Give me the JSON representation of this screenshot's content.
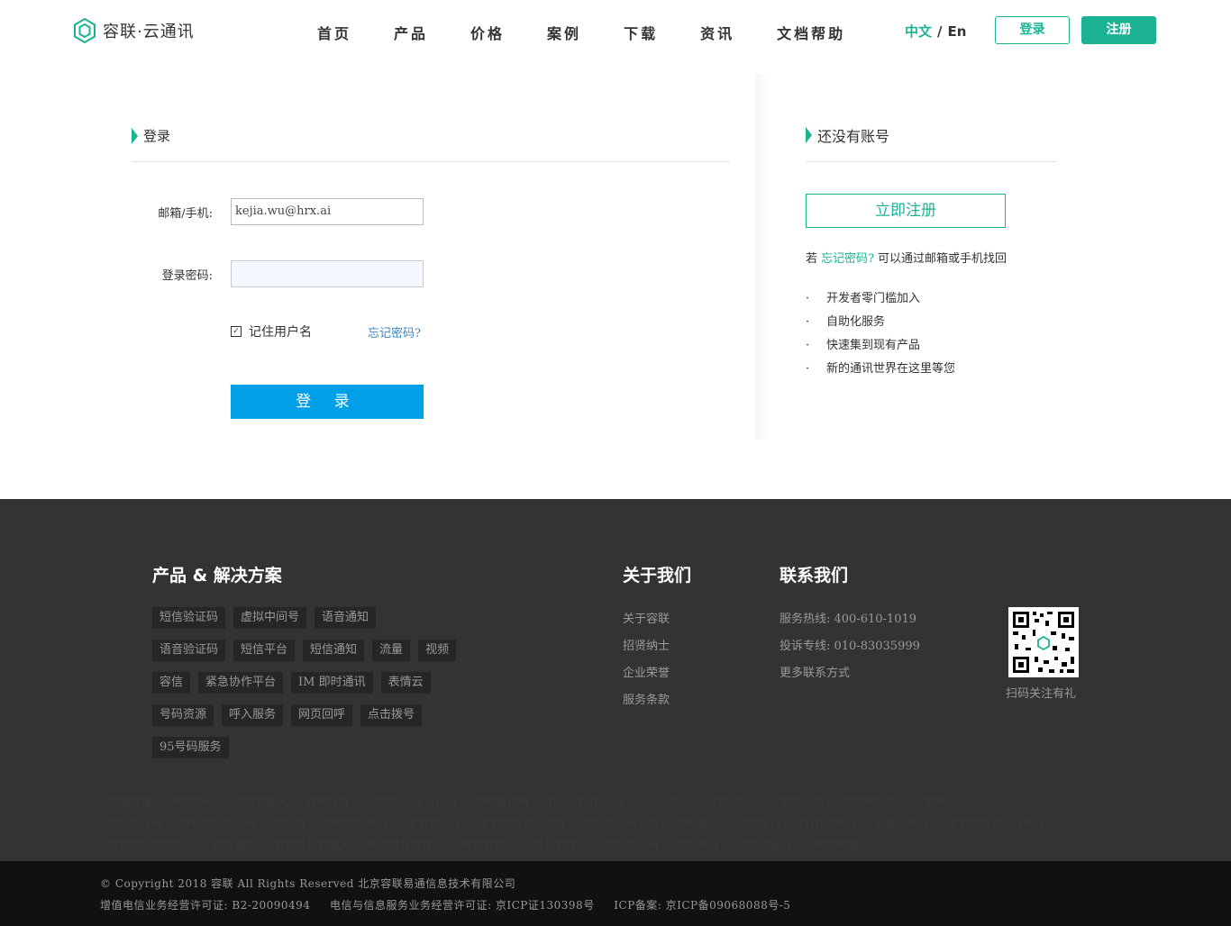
{
  "header": {
    "logo_text": "容联·云通讯",
    "nav": [
      "首页",
      "产品",
      "价格",
      "案例",
      "下载",
      "资讯",
      "文档帮助"
    ],
    "lang_zh": "中文",
    "lang_sep": "/",
    "lang_en": "En",
    "login_label": "登录",
    "register_label": "注册",
    "accent_color": "#1bb394"
  },
  "login": {
    "title": "登录",
    "email_label": "邮箱/手机:",
    "email_value": "kejia.wu@hrx.ai",
    "password_label": "登录密码:",
    "password_value": "",
    "remember_label": "记住用户名",
    "remember_checked": true,
    "forgot_label": "忘记密码?",
    "submit_label": "登 录",
    "submit_color": "#00a0e9"
  },
  "signup": {
    "title": "还没有账号",
    "register_now": "立即注册",
    "hint_prefix": "若",
    "hint_link": "忘记密码?",
    "hint_suffix": "可以通过邮箱或手机找回",
    "bullets": [
      "开发者零门槛加入",
      "自助化服务",
      "快速集到现有产品",
      "新的通讯世界在这里等您"
    ]
  },
  "footer": {
    "products_title": "产品 & 解决方案",
    "product_tags": [
      [
        "短信验证码",
        "虚拟中间号",
        "语音通知"
      ],
      [
        "语音验证码",
        "短信平台",
        "短信通知",
        "流量",
        "视频"
      ],
      [
        "容信",
        "紧急协作平台",
        "IM 即时通讯",
        "表情云"
      ],
      [
        "号码资源",
        "呼入服务",
        "网页回呼",
        "点击拨号"
      ],
      [
        "95号码服务"
      ]
    ],
    "about_title": "关于我们",
    "about_links": [
      "关于容联",
      "招贤纳士",
      "企业荣誉",
      "服务条款"
    ],
    "contact_title": "联系我们",
    "contact_lines": [
      "服务热线: 400-610-1019",
      "投诉专线: 010-83035999",
      "更多联系方式"
    ],
    "qr_label": "扫码关注有礼",
    "friend_links": [
      [
        "友情链接:",
        "呼叫中心",
        "语音机器人",
        "容易科技",
        "云服务",
        "Coding",
        "即时通讯网",
        "ThinkPHP",
        "Cocos",
        "移云",
        "API Store",
        "猫扑众测",
        "应用开发资讯",
        "更多>>"
      ],
      [
        "短信验证码",
        "手机短信验证码",
        "短信群",
        "手机短信平台",
        "手机验证码",
        "手机短信验证平台",
        "短信验证码平台",
        "即时通讯",
        "短信接口",
        "IM开发平台",
        "云通讯平台",
        "手机短信验证码平台"
      ],
      [
        "手机短信通知平台",
        "短信通知",
        "智能语音机器人",
        "电话语音机器人",
        "电销机器人",
        "语音机器人",
        "短信验证码",
        "短信平台",
        "短信验证码",
        "IM即时通讯"
      ]
    ],
    "copyright": "© Copyright 2018 容联 All Rights Reserved 北京容联易通信息技术有限公司",
    "license_1": "增值电信业务经营许可证: B2-20090494",
    "license_2": "电信与信息服务业务经营许可证: 京ICP证130398号",
    "license_3": "ICP备案: 京ICP备09068088号-5"
  }
}
